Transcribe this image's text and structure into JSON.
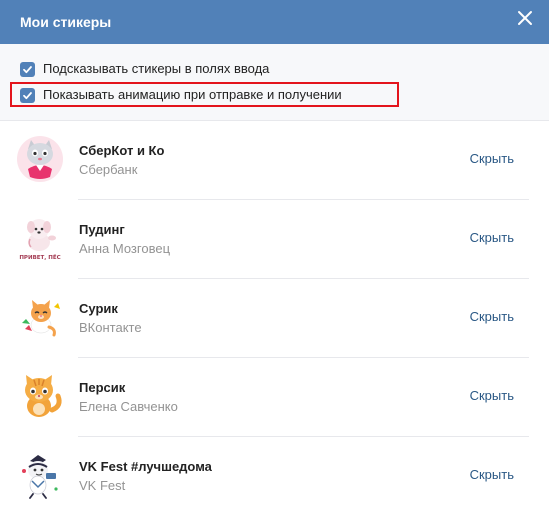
{
  "header": {
    "title": "Мои стикеры",
    "close_icon": "close-icon"
  },
  "settings": {
    "options": [
      {
        "label": "Подсказывать стикеры в полях ввода",
        "checked": true
      },
      {
        "label": "Показывать анимацию при отправке и получении",
        "checked": true
      }
    ],
    "highlight_color": "#e3141c"
  },
  "packs": [
    {
      "title": "СберКот и Ко",
      "author": "Сбербанк",
      "action": "Скрыть",
      "icon": "sberkot-sticker"
    },
    {
      "title": "Пудинг",
      "author": "Анна Мозговец",
      "action": "Скрыть",
      "icon": "puding-sticker",
      "sticker_caption": "ПРИВЕТ, ПЁС"
    },
    {
      "title": "Сурик",
      "author": "ВКонтакте",
      "action": "Скрыть",
      "icon": "surik-sticker"
    },
    {
      "title": "Персик",
      "author": "Елена Савченко",
      "action": "Скрыть",
      "icon": "persik-sticker"
    },
    {
      "title": "VK Fest #лучшедома",
      "author": "VK Fest",
      "action": "Скрыть",
      "icon": "vkfest-sticker"
    }
  ],
  "colors": {
    "header_bg": "#5181b8",
    "link": "#2a5885",
    "subtext": "#939393"
  }
}
